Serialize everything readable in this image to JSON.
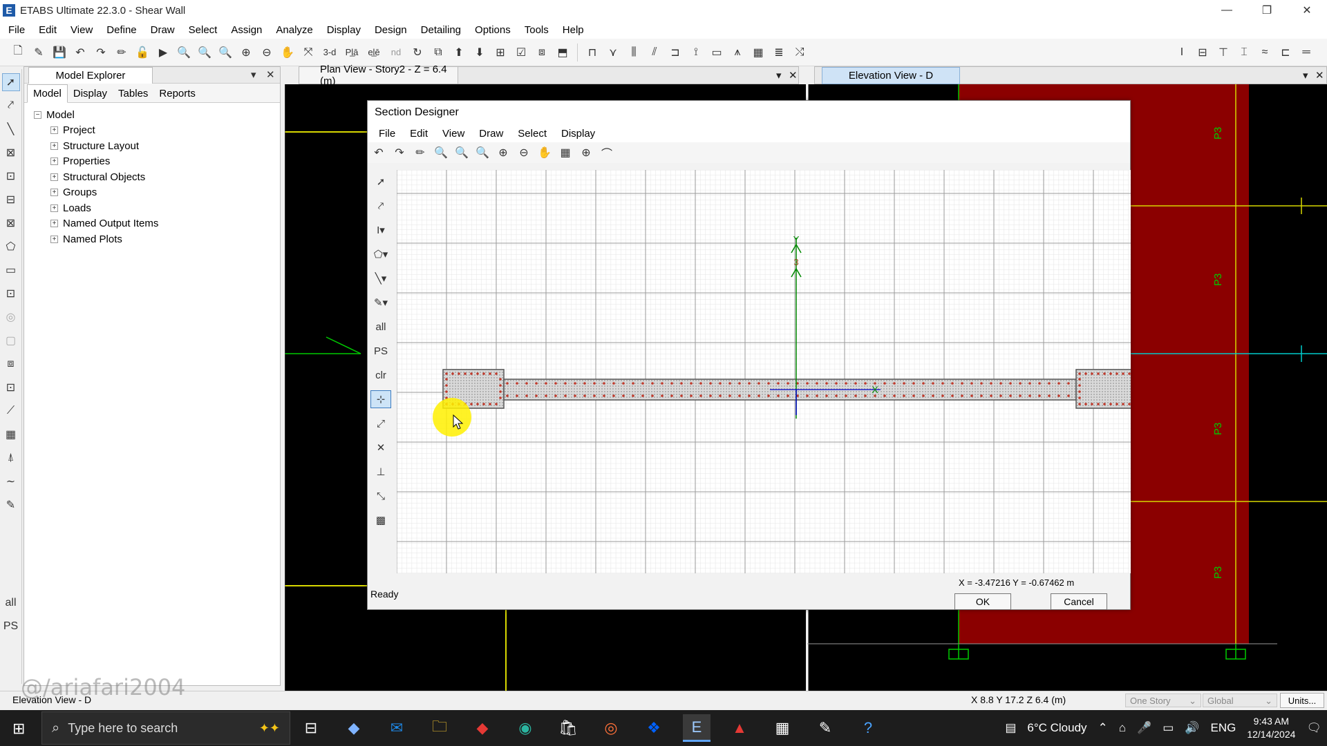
{
  "window": {
    "title": "ETABS Ultimate 22.3.0 - Shear Wall",
    "logo": "E",
    "controls": [
      "—",
      "❐",
      "✕"
    ]
  },
  "menu": [
    "File",
    "Edit",
    "View",
    "Define",
    "Draw",
    "Select",
    "Assign",
    "Analyze",
    "Display",
    "Design",
    "Detailing",
    "Options",
    "Tools",
    "Help"
  ],
  "toolbar_text": {
    "three_d": "3-d",
    "plan": "Pl̲ā",
    "elev": "el̲ē",
    "nd": "nd"
  },
  "explorer": {
    "title": "Model Explorer",
    "tabs": [
      "Model",
      "Display",
      "Tables",
      "Reports"
    ],
    "root": "Model",
    "items": [
      "Project",
      "Structure Layout",
      "Properties",
      "Structural Objects",
      "Groups",
      "Loads",
      "Named Output Items",
      "Named Plots"
    ]
  },
  "plan_view": {
    "title": "Plan View - Story2 - Z = 6.4 (m)"
  },
  "elevation_view": {
    "title": "Elevation View - D",
    "labels": [
      "P3",
      "P3",
      "P3",
      "P3"
    ]
  },
  "section_designer": {
    "title": "Section Designer",
    "menu": [
      "File",
      "Edit",
      "View",
      "Draw",
      "Select",
      "Display"
    ],
    "status": "Ready",
    "coords": "X = -3.47216    Y = -0.67462 m",
    "ok": "OK",
    "cancel": "Cancel",
    "side_text": {
      "all": "all",
      "ps": "PS",
      "clr": "clr"
    },
    "axis": {
      "y": "Y",
      "three": "3",
      "x": "X"
    }
  },
  "statusbar": {
    "left": "Elevation View - D",
    "coord": "X 8.8  Y 17.2  Z 6.4 (m)",
    "story": "One Story",
    "system": "Global",
    "units": "Units..."
  },
  "taskbar": {
    "search_placeholder": "Type here to search",
    "weather": "6°C  Cloudy",
    "lang": "ENG",
    "time": "9:43 AM",
    "date": "12/14/2024"
  },
  "watermark": "@/ariafari2004",
  "colors": {
    "elevation_red": "#8b0000",
    "grid": "#e0e0e0",
    "rebar": "#c0392b",
    "accent_yellow": "#d8d800",
    "accent_green": "#00cc00"
  }
}
